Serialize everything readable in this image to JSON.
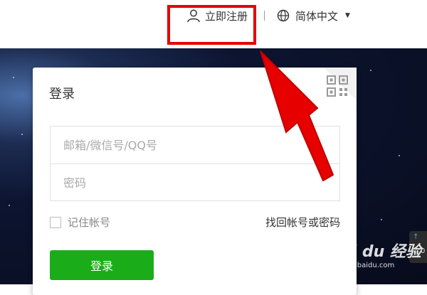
{
  "header": {
    "register_label": "立即注册",
    "language_label": "简体中文"
  },
  "login": {
    "title": "登录",
    "account_placeholder": "邮箱/微信号/QQ号",
    "password_placeholder": "密码",
    "remember_label": "记住帐号",
    "forgot_label": "找回帐号或密码",
    "submit_label": "登录"
  },
  "side_widget": {
    "count": "0"
  },
  "watermark": {
    "main": "Bai du 经验",
    "sub": "jingyan.baidu.com"
  },
  "colors": {
    "accent_green": "#1aad19",
    "annotation_red": "#e60000"
  },
  "icons": [
    "user-icon",
    "globe-icon",
    "caret-down-icon",
    "qr-code-icon"
  ]
}
